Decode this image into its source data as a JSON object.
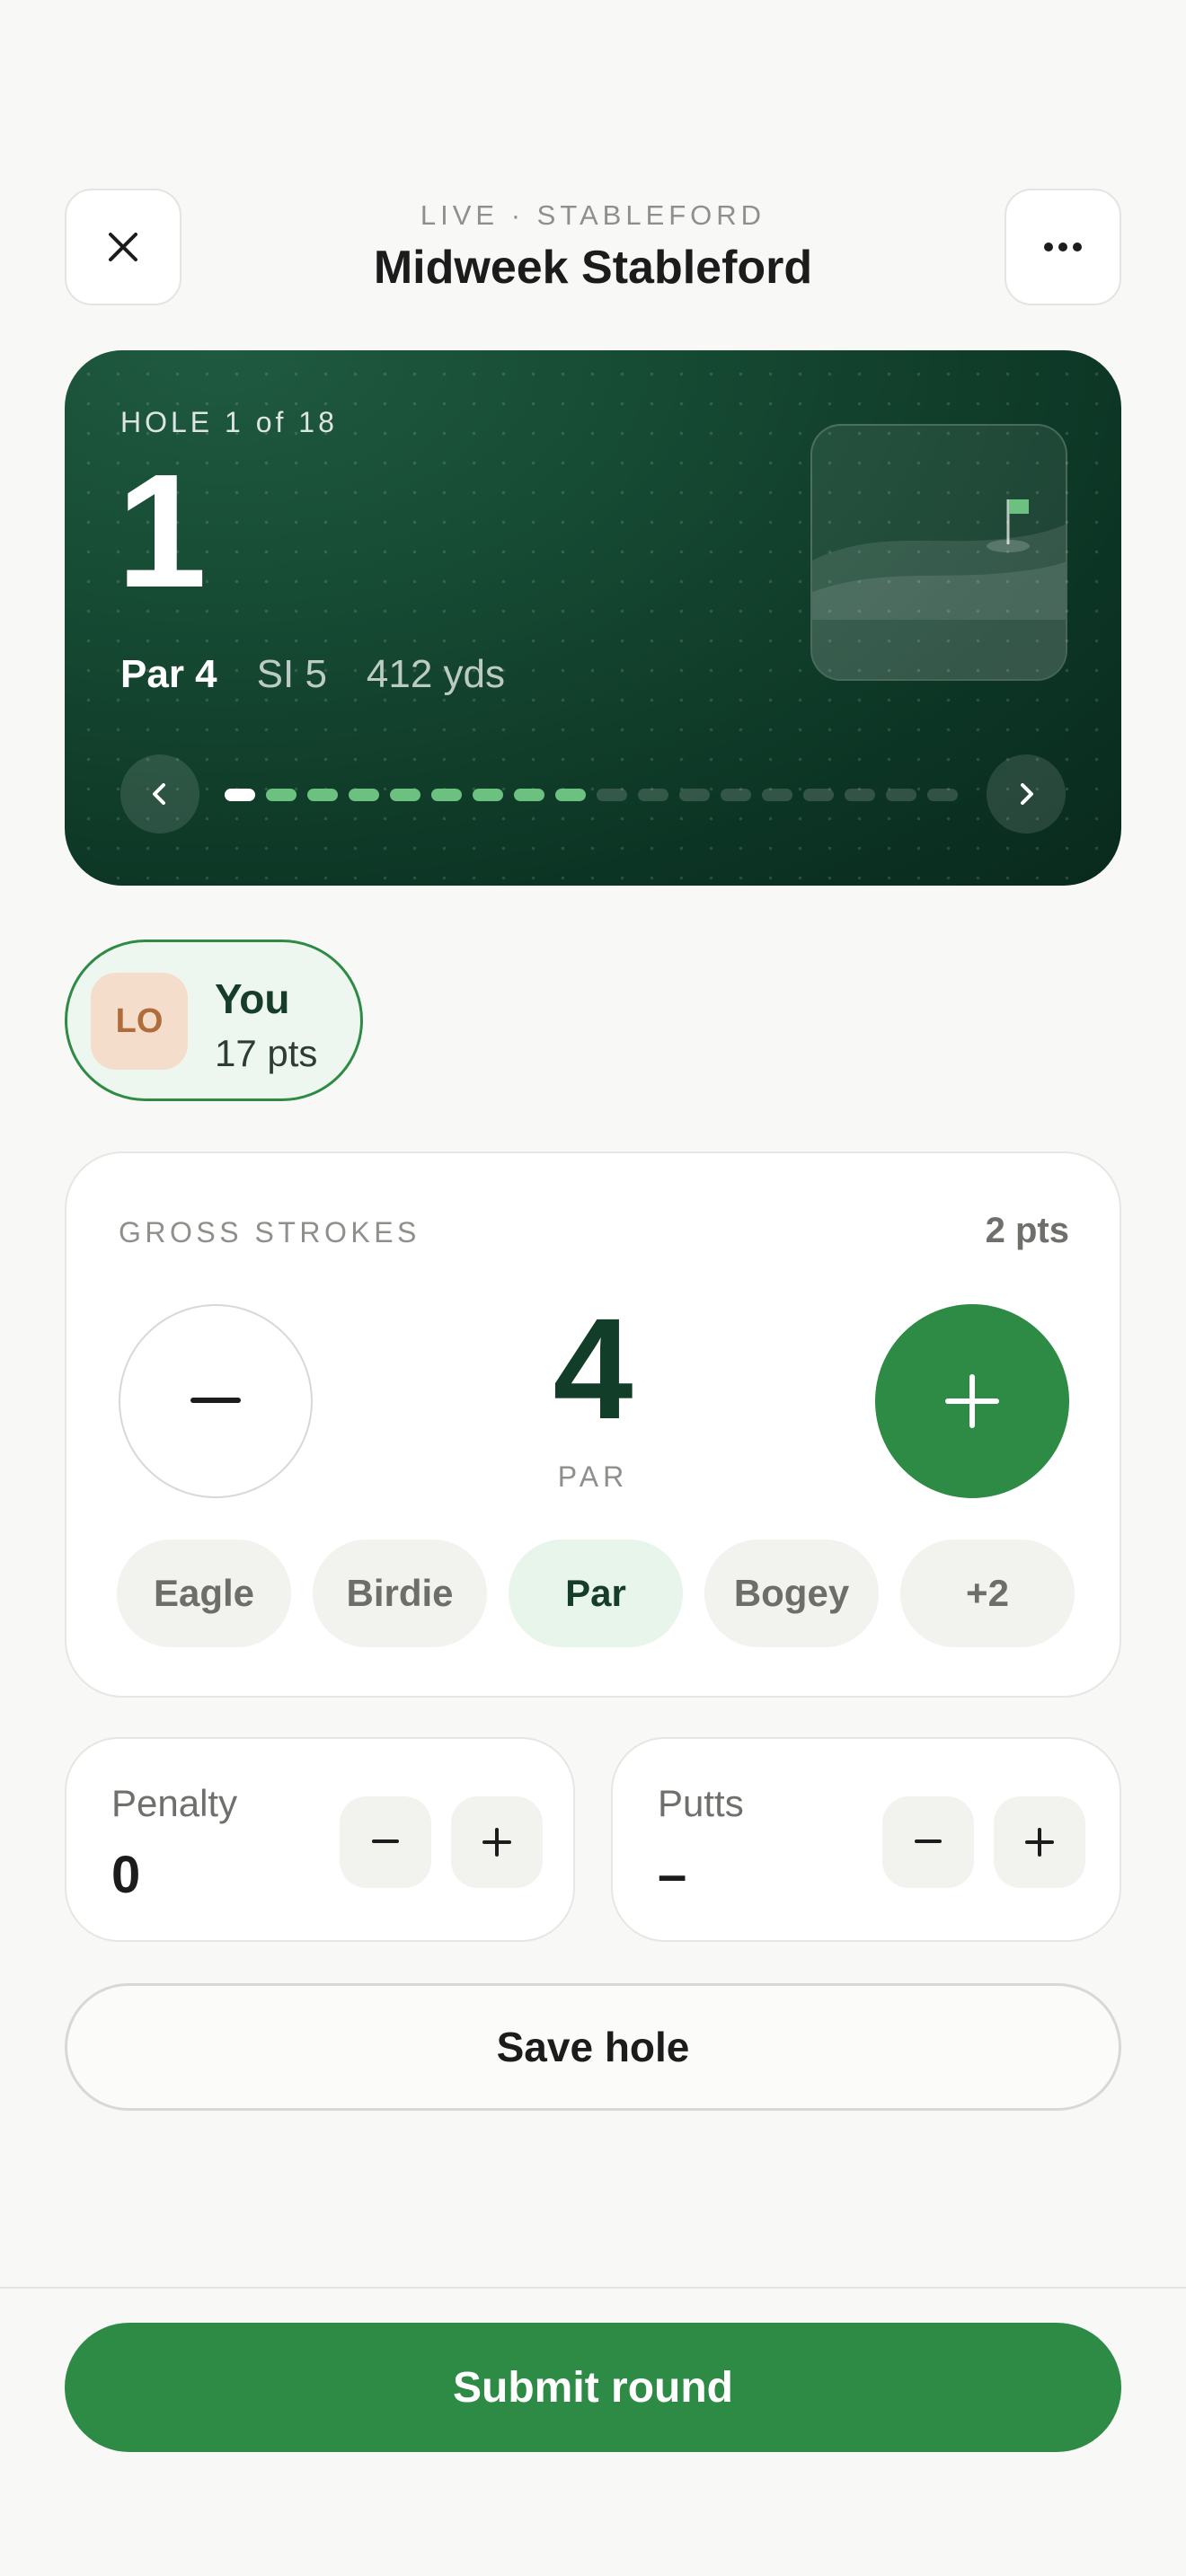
{
  "header": {
    "eyebrow": "LIVE · STABLEFORD",
    "title": "Midweek Stableford",
    "close_icon": "close-icon",
    "menu_icon": "more-horizontal-icon"
  },
  "hole": {
    "label": "HOLE 1 of 18",
    "number": "1",
    "par": "Par 4",
    "stroke_index": "SI 5",
    "yardage": "412 yds",
    "total_holes": 18,
    "current_hole": 1,
    "holes_completed_markers": 8,
    "prev_icon": "chevron-left-icon",
    "next_icon": "chevron-right-icon",
    "thumbnail_icon": "golf-hole-flag-icon"
  },
  "player": {
    "initials": "LO",
    "name": "You",
    "points": "17 pts"
  },
  "strokes": {
    "label": "GROSS STROKES",
    "points": "2 pts",
    "value": "4",
    "result": "PAR",
    "minus_symbol": "–",
    "plus_symbol": "+",
    "quick_options": [
      "Eagle",
      "Birdie",
      "Par",
      "Bogey",
      "+2"
    ],
    "selected_option": "Par"
  },
  "penalty": {
    "label": "Penalty",
    "value": "0"
  },
  "putts": {
    "label": "Putts",
    "value": "–"
  },
  "actions": {
    "save": "Save hole",
    "submit": "Submit round"
  },
  "colors": {
    "accent": "#2e8b45",
    "card_dark": "#0c3424",
    "progress_done": "#6cc080"
  }
}
